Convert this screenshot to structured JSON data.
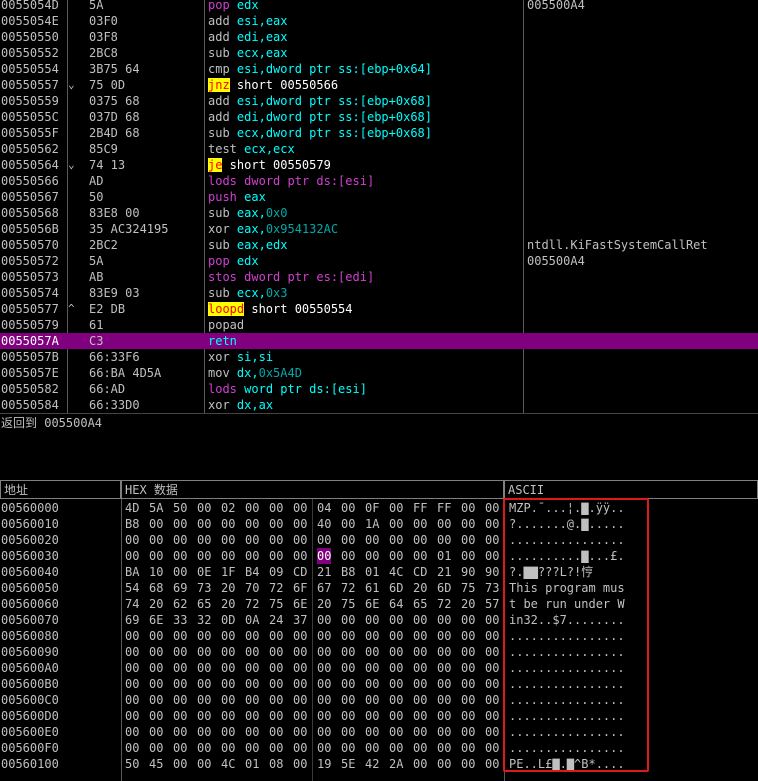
{
  "disasm": {
    "rows": [
      {
        "addr": "0055054D",
        "arrow": "",
        "hex": "5A",
        "instr": [
          [
            "pushpop",
            "pop"
          ],
          [
            "plain",
            " "
          ],
          [
            "rg",
            "edx"
          ]
        ],
        "comment": "005500A4"
      },
      {
        "addr": "0055054E",
        "arrow": "",
        "hex": "03F0",
        "instr": [
          [
            "mn",
            "add"
          ],
          [
            "plain",
            " "
          ],
          [
            "rg",
            "esi,eax"
          ]
        ],
        "comment": ""
      },
      {
        "addr": "00550550",
        "arrow": "",
        "hex": "03F8",
        "instr": [
          [
            "mn",
            "add"
          ],
          [
            "plain",
            " "
          ],
          [
            "rg",
            "edi,eax"
          ]
        ],
        "comment": ""
      },
      {
        "addr": "00550552",
        "arrow": "",
        "hex": "2BC8",
        "instr": [
          [
            "mn",
            "sub"
          ],
          [
            "plain",
            " "
          ],
          [
            "rg",
            "ecx,eax"
          ]
        ],
        "comment": ""
      },
      {
        "addr": "00550554",
        "arrow": "",
        "hex": "3B75 64",
        "instr": [
          [
            "mn",
            "cmp"
          ],
          [
            "plain",
            " "
          ],
          [
            "mem",
            "esi,dword ptr ss:[ebp+0x64]"
          ]
        ],
        "comment": ""
      },
      {
        "addr": "00550557",
        "arrow": "⌄",
        "hex": "75 0D",
        "instr": [
          [
            "jcc",
            "jnz"
          ],
          [
            "plain",
            " short 00550566"
          ]
        ],
        "comment": ""
      },
      {
        "addr": "00550559",
        "arrow": "",
        "hex": "0375 68",
        "instr": [
          [
            "mn",
            "add"
          ],
          [
            "plain",
            " "
          ],
          [
            "mem",
            "esi,dword ptr ss:[ebp+0x68]"
          ]
        ],
        "comment": ""
      },
      {
        "addr": "0055055C",
        "arrow": "",
        "hex": "037D 68",
        "instr": [
          [
            "mn",
            "add"
          ],
          [
            "plain",
            " "
          ],
          [
            "mem",
            "edi,dword ptr ss:[ebp+0x68]"
          ]
        ],
        "comment": ""
      },
      {
        "addr": "0055055F",
        "arrow": "",
        "hex": "2B4D 68",
        "instr": [
          [
            "mn",
            "sub"
          ],
          [
            "plain",
            " "
          ],
          [
            "mem",
            "ecx,dword ptr ss:[ebp+0x68]"
          ]
        ],
        "comment": ""
      },
      {
        "addr": "00550562",
        "arrow": "",
        "hex": "85C9",
        "instr": [
          [
            "mn",
            "test"
          ],
          [
            "plain",
            " "
          ],
          [
            "rg",
            "ecx,ecx"
          ]
        ],
        "comment": ""
      },
      {
        "addr": "00550564",
        "arrow": "⌄",
        "hex": "74 13",
        "instr": [
          [
            "jcc",
            "je"
          ],
          [
            "plain",
            " short 00550579"
          ]
        ],
        "comment": ""
      },
      {
        "addr": "00550566",
        "arrow": "",
        "hex": "AD",
        "instr": [
          [
            "mn",
            "lods"
          ],
          [
            "plain",
            " "
          ],
          [
            "memm",
            "dword ptr ds:[esi]"
          ]
        ],
        "comment": ""
      },
      {
        "addr": "00550567",
        "arrow": "",
        "hex": "50",
        "instr": [
          [
            "pushpop",
            "push"
          ],
          [
            "plain",
            " "
          ],
          [
            "rg",
            "eax"
          ]
        ],
        "comment": ""
      },
      {
        "addr": "00550568",
        "arrow": "",
        "hex": "83E8 00",
        "instr": [
          [
            "mn",
            "sub"
          ],
          [
            "plain",
            " "
          ],
          [
            "rg",
            "eax,"
          ],
          [
            "imm",
            "0x0"
          ]
        ],
        "comment": ""
      },
      {
        "addr": "0055056B",
        "arrow": "",
        "hex": "35 AC324195",
        "instr": [
          [
            "mn",
            "xor"
          ],
          [
            "plain",
            " "
          ],
          [
            "rg",
            "eax,"
          ],
          [
            "imm",
            "0x954132AC"
          ]
        ],
        "comment": ""
      },
      {
        "addr": "00550570",
        "arrow": "",
        "hex": "2BC2",
        "instr": [
          [
            "mn",
            "sub"
          ],
          [
            "plain",
            " "
          ],
          [
            "rg",
            "eax,edx"
          ]
        ],
        "comment": "ntdll.KiFastSystemCallRet"
      },
      {
        "addr": "00550572",
        "arrow": "",
        "hex": "5A",
        "instr": [
          [
            "pushpop",
            "pop"
          ],
          [
            "plain",
            " "
          ],
          [
            "rg",
            "edx"
          ]
        ],
        "comment": "005500A4"
      },
      {
        "addr": "00550573",
        "arrow": "",
        "hex": "AB",
        "instr": [
          [
            "mn",
            "stos"
          ],
          [
            "plain",
            " "
          ],
          [
            "memm",
            "dword ptr es:[edi]"
          ]
        ],
        "comment": ""
      },
      {
        "addr": "00550574",
        "arrow": "",
        "hex": "83E9 03",
        "instr": [
          [
            "mn",
            "sub"
          ],
          [
            "plain",
            " "
          ],
          [
            "rg",
            "ecx,"
          ],
          [
            "imm",
            "0x3"
          ]
        ],
        "comment": ""
      },
      {
        "addr": "00550577",
        "arrow": "^",
        "hex": "E2 DB",
        "instr": [
          [
            "jcc",
            "loopd"
          ],
          [
            "plain",
            " short 00550554"
          ]
        ],
        "comment": ""
      },
      {
        "addr": "00550579",
        "arrow": "",
        "hex": "61",
        "instr": [
          [
            "mn",
            "popad"
          ]
        ],
        "comment": ""
      },
      {
        "addr": "0055057A",
        "arrow": "",
        "hex": "C3",
        "instr": [
          [
            "ret",
            "retn"
          ]
        ],
        "comment": "",
        "selected": true
      },
      {
        "addr": "0055057B",
        "arrow": "",
        "hex": "66:33F6",
        "instr": [
          [
            "mn",
            "xor"
          ],
          [
            "plain",
            " "
          ],
          [
            "rg",
            "si,si"
          ]
        ],
        "comment": ""
      },
      {
        "addr": "0055057E",
        "arrow": "",
        "hex": "66:BA 4D5A",
        "instr": [
          [
            "mn",
            "mov"
          ],
          [
            "plain",
            " "
          ],
          [
            "rg",
            "dx,"
          ],
          [
            "imm",
            "0x5A4D"
          ]
        ],
        "comment": ""
      },
      {
        "addr": "00550582",
        "arrow": "",
        "hex": "66:AD",
        "instr": [
          [
            "mn",
            "lods"
          ],
          [
            "plain",
            " "
          ],
          [
            "mem",
            "word ptr ds:[esi]"
          ]
        ],
        "comment": ""
      },
      {
        "addr": "00550584",
        "arrow": "",
        "hex": "66:33D0",
        "instr": [
          [
            "mn",
            "xor"
          ],
          [
            "plain",
            " "
          ],
          [
            "rg",
            "dx,ax"
          ]
        ],
        "comment": ""
      }
    ]
  },
  "info": {
    "text": "返回到 005500A4"
  },
  "dump": {
    "headers": {
      "address": "地址",
      "hex": "HEX 数据",
      "ascii": "ASCII"
    },
    "rows": [
      {
        "addr": "00560000",
        "bytes": [
          "4D",
          "5A",
          "50",
          "00",
          "02",
          "00",
          "00",
          "00",
          "04",
          "00",
          "0F",
          "00",
          "FF",
          "FF",
          "00",
          "00"
        ],
        "ascii": "MZP.¯...¦.▇.ÿÿ.."
      },
      {
        "addr": "00560010",
        "bytes": [
          "B8",
          "00",
          "00",
          "00",
          "00",
          "00",
          "00",
          "00",
          "40",
          "00",
          "1A",
          "00",
          "00",
          "00",
          "00",
          "00"
        ],
        "ascii": "?.......@.▇....."
      },
      {
        "addr": "00560020",
        "bytes": [
          "00",
          "00",
          "00",
          "00",
          "00",
          "00",
          "00",
          "00",
          "00",
          "00",
          "00",
          "00",
          "00",
          "00",
          "00",
          "00"
        ],
        "ascii": "................"
      },
      {
        "addr": "00560030",
        "bytes": [
          "00",
          "00",
          "00",
          "00",
          "00",
          "00",
          "00",
          "00",
          "00",
          "00",
          "00",
          "00",
          "00",
          "01",
          "00",
          "00"
        ],
        "ascii": "..........▇...£.",
        "hl": 8
      },
      {
        "addr": "00560040",
        "bytes": [
          "BA",
          "10",
          "00",
          "0E",
          "1F",
          "B4",
          "09",
          "CD",
          "21",
          "B8",
          "01",
          "4C",
          "CD",
          "21",
          "90",
          "90"
        ],
        "ascii": "?.▇▇???L?!悙"
      },
      {
        "addr": "00560050",
        "bytes": [
          "54",
          "68",
          "69",
          "73",
          "20",
          "70",
          "72",
          "6F",
          "67",
          "72",
          "61",
          "6D",
          "20",
          "6D",
          "75",
          "73"
        ],
        "ascii": "This program mus"
      },
      {
        "addr": "00560060",
        "bytes": [
          "74",
          "20",
          "62",
          "65",
          "20",
          "72",
          "75",
          "6E",
          "20",
          "75",
          "6E",
          "64",
          "65",
          "72",
          "20",
          "57"
        ],
        "ascii": "t be run under W"
      },
      {
        "addr": "00560070",
        "bytes": [
          "69",
          "6E",
          "33",
          "32",
          "0D",
          "0A",
          "24",
          "37",
          "00",
          "00",
          "00",
          "00",
          "00",
          "00",
          "00",
          "00"
        ],
        "ascii": "in32..$7........"
      },
      {
        "addr": "00560080",
        "bytes": [
          "00",
          "00",
          "00",
          "00",
          "00",
          "00",
          "00",
          "00",
          "00",
          "00",
          "00",
          "00",
          "00",
          "00",
          "00",
          "00"
        ],
        "ascii": "................"
      },
      {
        "addr": "00560090",
        "bytes": [
          "00",
          "00",
          "00",
          "00",
          "00",
          "00",
          "00",
          "00",
          "00",
          "00",
          "00",
          "00",
          "00",
          "00",
          "00",
          "00"
        ],
        "ascii": "................"
      },
      {
        "addr": "005600A0",
        "bytes": [
          "00",
          "00",
          "00",
          "00",
          "00",
          "00",
          "00",
          "00",
          "00",
          "00",
          "00",
          "00",
          "00",
          "00",
          "00",
          "00"
        ],
        "ascii": "................"
      },
      {
        "addr": "005600B0",
        "bytes": [
          "00",
          "00",
          "00",
          "00",
          "00",
          "00",
          "00",
          "00",
          "00",
          "00",
          "00",
          "00",
          "00",
          "00",
          "00",
          "00"
        ],
        "ascii": "................"
      },
      {
        "addr": "005600C0",
        "bytes": [
          "00",
          "00",
          "00",
          "00",
          "00",
          "00",
          "00",
          "00",
          "00",
          "00",
          "00",
          "00",
          "00",
          "00",
          "00",
          "00"
        ],
        "ascii": "................"
      },
      {
        "addr": "005600D0",
        "bytes": [
          "00",
          "00",
          "00",
          "00",
          "00",
          "00",
          "00",
          "00",
          "00",
          "00",
          "00",
          "00",
          "00",
          "00",
          "00",
          "00"
        ],
        "ascii": "................"
      },
      {
        "addr": "005600E0",
        "bytes": [
          "00",
          "00",
          "00",
          "00",
          "00",
          "00",
          "00",
          "00",
          "00",
          "00",
          "00",
          "00",
          "00",
          "00",
          "00",
          "00"
        ],
        "ascii": "................"
      },
      {
        "addr": "005600F0",
        "bytes": [
          "00",
          "00",
          "00",
          "00",
          "00",
          "00",
          "00",
          "00",
          "00",
          "00",
          "00",
          "00",
          "00",
          "00",
          "00",
          "00"
        ],
        "ascii": "................"
      },
      {
        "addr": "00560100",
        "bytes": [
          "50",
          "45",
          "00",
          "00",
          "4C",
          "01",
          "08",
          "00",
          "19",
          "5E",
          "42",
          "2A",
          "00",
          "00",
          "00",
          "00"
        ],
        "ascii": "PE..L£▇.▇^B*...."
      }
    ]
  }
}
